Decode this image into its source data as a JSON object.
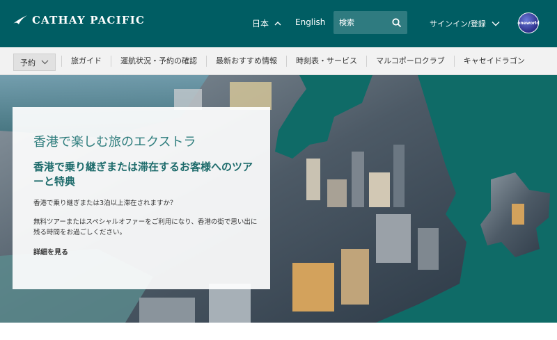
{
  "header": {
    "logo_text": "CATHAY PACIFIC",
    "language_current": "日本",
    "language_alt": "English",
    "search_placeholder": "検索",
    "signin_label": "サインイン/登録",
    "alliance_badge": "oneworld",
    "bg_color": "#005d63"
  },
  "nav": {
    "book_label": "予約",
    "items": [
      {
        "label": "旅ガイド"
      },
      {
        "label": "運航状況・予約の確認"
      },
      {
        "label": "最新おすすめ情報"
      },
      {
        "label": "時刻表・サービス"
      },
      {
        "label": "マルコポーロクラブ"
      },
      {
        "label": "キャセイドラゴン"
      }
    ]
  },
  "hero": {
    "title": "香港で楽しむ旅のエクストラ",
    "subtitle": "香港で乗り継ぎまたは滞在するお客様へのツアーと特典",
    "question": "香港で乗り継ぎまたは3泊以上滞在されますか？",
    "description": "無料ツアーまたはスペシャルオファーをご利用になり、香港の街で思い出に残る時間をお過ごしください。",
    "link_label": "詳細を見る",
    "accent_color": "#2e7d7d",
    "bg_color": "#0f6b67"
  }
}
